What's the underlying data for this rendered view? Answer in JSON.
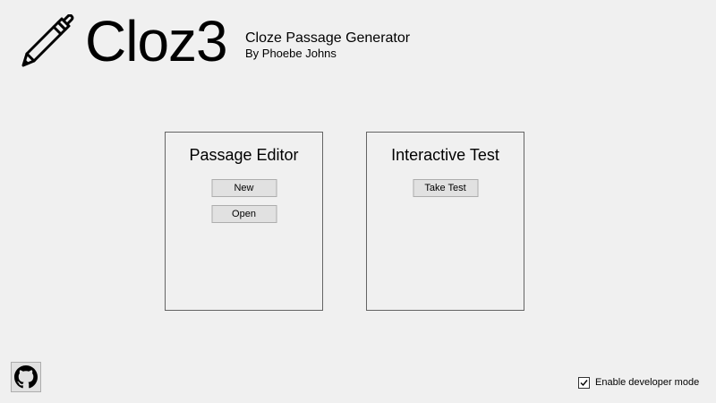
{
  "header": {
    "app_name": "Cloz3",
    "subtitle": "Cloze Passage Generator",
    "byline": "By Phoebe Johns",
    "logo_icon": "pencil-icon"
  },
  "panels": {
    "editor": {
      "title": "Passage Editor",
      "buttons": {
        "new": "New",
        "open": "Open"
      }
    },
    "test": {
      "title": "Interactive Test",
      "buttons": {
        "take_test": "Take Test"
      }
    }
  },
  "footer": {
    "github_icon": "github-icon",
    "developer_mode": {
      "label": "Enable developer mode",
      "checked": true
    }
  },
  "colors": {
    "background": "#f0f0f0",
    "button_face": "#e1e1e1",
    "button_border": "#adadad",
    "panel_border": "#646464"
  }
}
